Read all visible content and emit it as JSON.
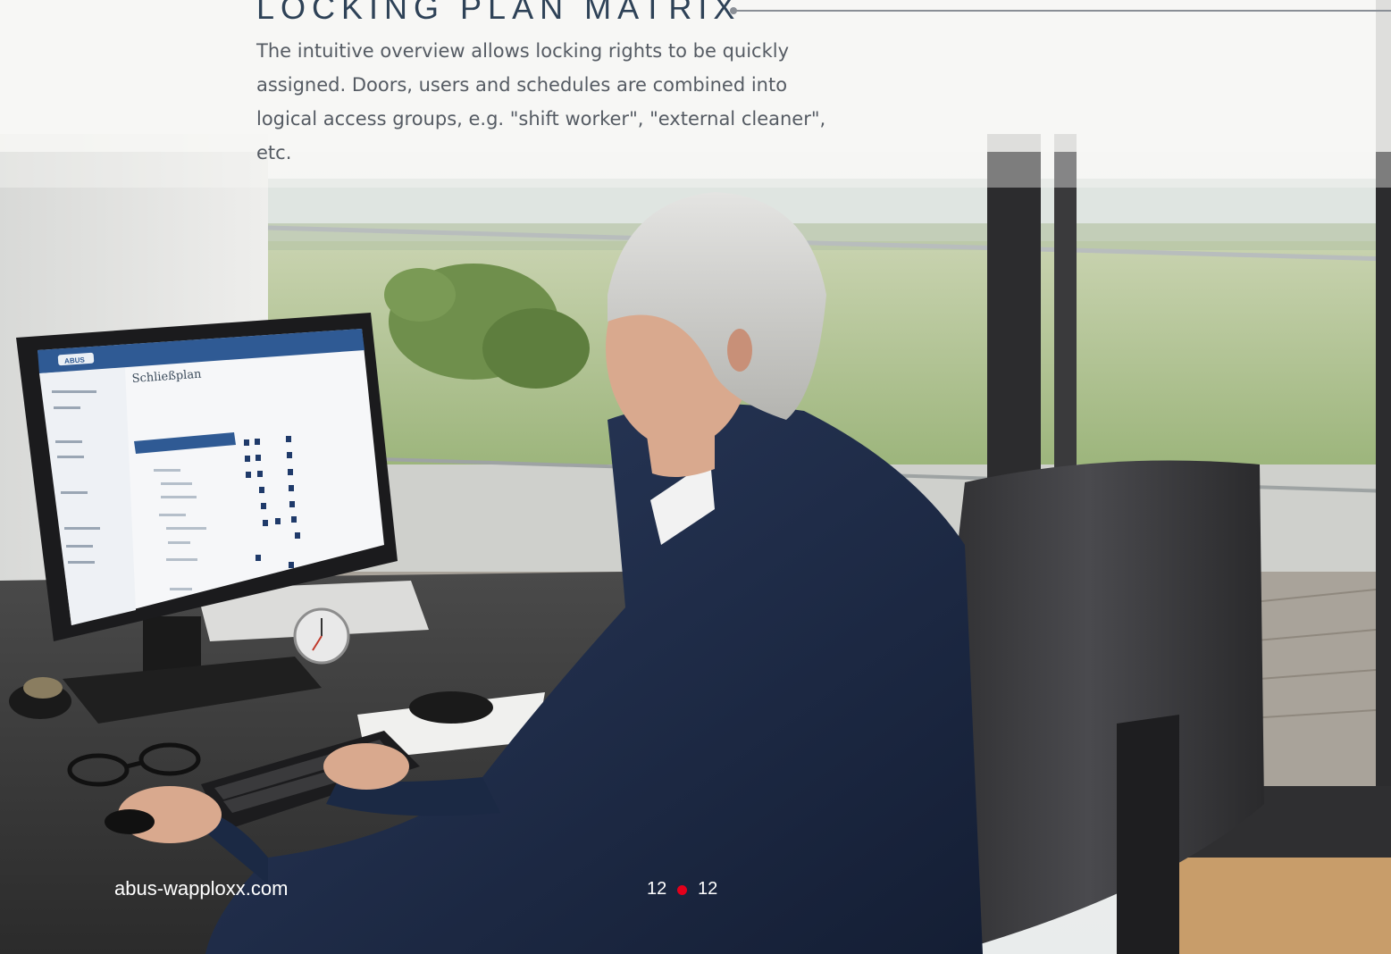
{
  "header": {
    "title": "LOCKING PLAN MATRIX",
    "intro": "The intuitive overview allows locking rights to be quickly assigned. Doors, users and schedules are combined into logical access groups, e.g. \"shift worker\", \"external cleaner\", etc."
  },
  "footer": {
    "website": "abus-wapploxx.com",
    "page_left": "12",
    "page_right": "12"
  },
  "monitor": {
    "brand": "ABUS",
    "heading": "Schließplan"
  },
  "colors": {
    "accent_red": "#e3001b",
    "screen_blue": "#2f5a94",
    "navy_suit": "#1d2b47"
  }
}
